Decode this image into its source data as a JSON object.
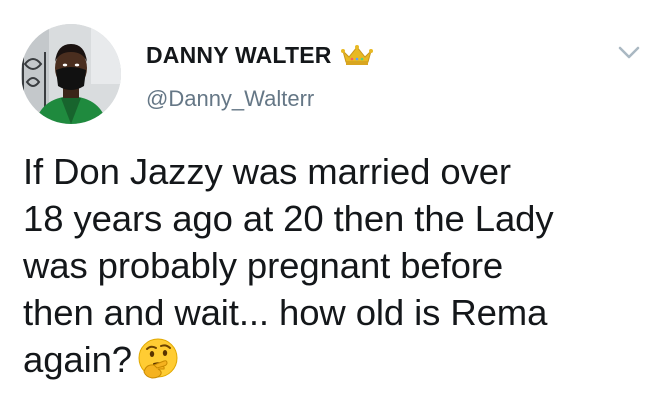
{
  "author": {
    "display_name": "DANNY WALTER",
    "badge_icon": "crown-icon",
    "handle": "@Danny_Walterr",
    "avatar_icon": "profile-photo"
  },
  "menu": {
    "icon": "chevron-down-icon"
  },
  "tweet": {
    "lines": [
      "If Don Jazzy was married over",
      "18 years ago at 20 then the Lady",
      "was probably pregnant before",
      "then and wait... how old is Rema",
      "again?"
    ],
    "emoji": "thinking-face-emoji"
  },
  "colors": {
    "text": "#14171a",
    "secondary_text": "#657786",
    "crown_gold": "#e8b923",
    "caret": "#aab8c2"
  }
}
